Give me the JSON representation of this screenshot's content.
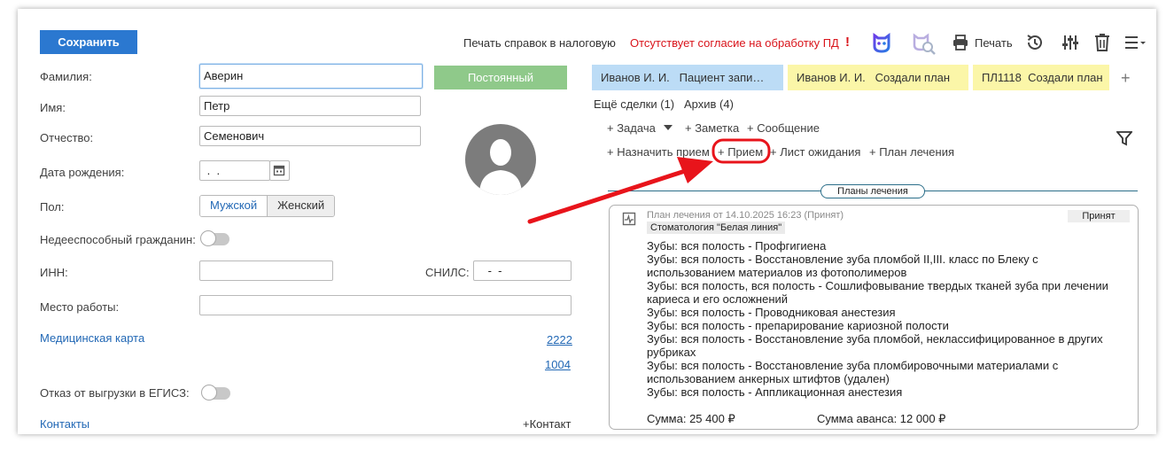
{
  "toolbar": {
    "save_label": "Сохранить",
    "print_tax_label": "Печать справок в налоговую",
    "consent_warning": "Отсутствует согласие на обработку ПД",
    "consent_mark": "!",
    "print_label": "Печать"
  },
  "form": {
    "surname_label": "Фамилия:",
    "surname_value": "Аверин",
    "name_label": "Имя:",
    "name_value": "Петр",
    "patronymic_label": "Отчество:",
    "patronymic_value": "Семенович",
    "birthdate_label": "Дата рождения:",
    "birthdate_value": " .  .",
    "gender_label": "Пол:",
    "gender_male": "Мужской",
    "gender_female": "Женский",
    "incapable_label": "Недееспособный гражданин:",
    "inn_label": "ИНН:",
    "inn_value": "",
    "snils_label": "СНИЛС:",
    "snils_value": " -  -",
    "workplace_label": "Место работы:",
    "workplace_value": "",
    "medcard_label": "Медицинская карта",
    "medcard_numbers": [
      "2222",
      "1004"
    ],
    "egisz_label": "Отказ от выгрузки в ЕГИСЗ:",
    "contacts_label": "Контакты",
    "add_contact_label": "+Контакт",
    "status_button": "Постоянный"
  },
  "tabs": [
    {
      "doctor": "Иванов И. И.",
      "text": "Пациент запи…",
      "color": "#bcdcf6"
    },
    {
      "doctor": "Иванов И. И.",
      "text": "Создали план",
      "color": "#fbf6a8"
    },
    {
      "doctor": "ПЛ1118",
      "text": "Создали план",
      "color": "#fbf6a8"
    }
  ],
  "tabs_add": "+",
  "deals": {
    "more": "Ещё сделки (1)",
    "archive": "Архив (4)"
  },
  "actions": {
    "task": "+ Задача",
    "note": "+ Заметка",
    "message": "+ Сообщение",
    "assign": "+ Назначить прием",
    "appointment": "+ Прием",
    "waitlist": "+ Лист ожидания",
    "treatment_plan": "+ План лечения"
  },
  "plans_section": "Планы лечения",
  "plan": {
    "header": "План лечения от 14.10.2025 16:23 (Принят)",
    "clinic": "Стоматология \"Белая линия\"",
    "status": "Принят",
    "lines": [
      "Зубы: вся полость - Профгигиена",
      "Зубы: вся полость - Восстановление зуба пломбой II,III. класс по Блеку с",
      "использованием материалов из фотополимеров",
      "Зубы: вся полость, вся полость - Сошлифовывание твердых тканей зуба при лечении",
      "кариеса и его осложнений",
      "Зубы: вся полость - Проводниковая анестезия",
      "Зубы: вся полость - препарирование кариозной полости",
      "Зубы: вся полость - Восстановление зуба пломбой, неклассифицированное в других",
      "рубриках",
      "Зубы: вся полость - Восстановление зуба пломбировочными материалами с",
      "использованием анкерных штифтов (удален)",
      "Зубы: вся полость - Аппликационная анестезия"
    ],
    "sum_label": "Сумма: 25 400 ₽",
    "advance_label": "Сумма аванса: 12 000 ₽"
  },
  "colors": {
    "accent": "#2b78d0",
    "warning": "#d9141b",
    "status_green": "#8fc98a",
    "annotation_red": "#e8141b"
  }
}
